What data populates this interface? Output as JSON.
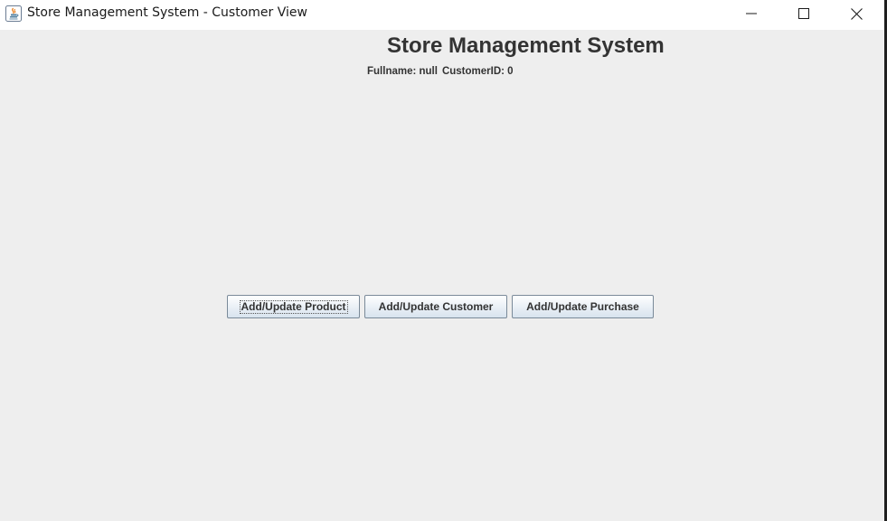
{
  "window": {
    "title": "Store Management System - Customer View",
    "controls": {
      "minimize": "minimize-icon",
      "maximize": "maximize-icon",
      "close": "close-icon"
    }
  },
  "main": {
    "heading": "Store Management System",
    "fullname_text": "Fullname: null",
    "customer_id_text": "CustomerID: 0"
  },
  "buttons": {
    "add_update_product": "Add/Update Product",
    "add_update_customer": "Add/Update Customer",
    "add_update_purchase": "Add/Update Purchase"
  },
  "colors": {
    "window_background": "#eeeeee",
    "titlebar_background": "#ffffff",
    "text": "#333333",
    "button_border": "#7a8a99"
  }
}
